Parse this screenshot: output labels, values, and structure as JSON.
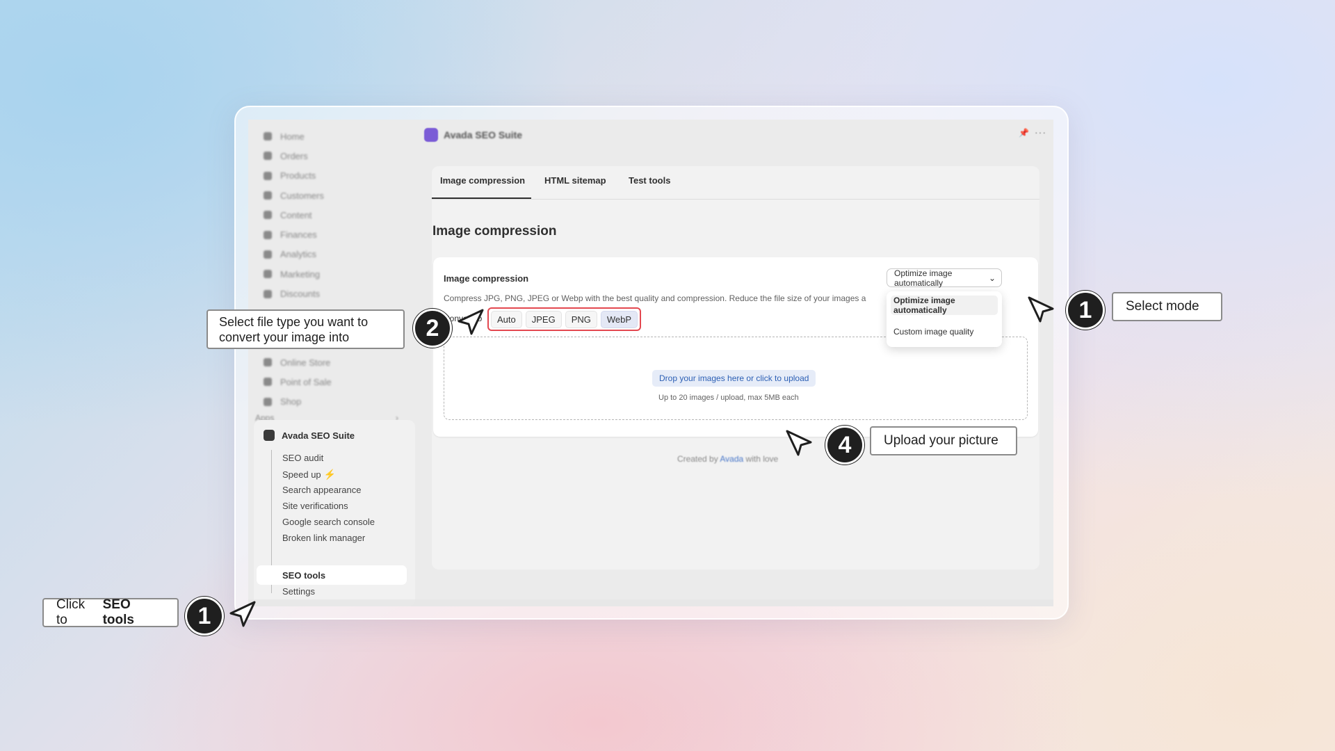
{
  "sidebar": {
    "nav_items": [
      "Home",
      "Orders",
      "Products",
      "Customers",
      "Content",
      "Finances",
      "Analytics",
      "Marketing",
      "Discounts"
    ],
    "sales_channels": [
      "Online Store",
      "Point of Sale",
      "Shop"
    ],
    "apps_label": "Apps",
    "app_name": "Avada SEO Suite",
    "app_subitems": [
      "SEO audit",
      "Speed up",
      "Search appearance",
      "Site verifications",
      "Google search console",
      "Broken link manager",
      "SEO tools",
      "Settings"
    ]
  },
  "topbar": {
    "title": "Avada SEO Suite",
    "more": "···"
  },
  "tabs": [
    "Image compression",
    "HTML sitemap",
    "Test tools"
  ],
  "page": {
    "heading": "Image compression",
    "card_title": "Image compression",
    "description": "Compress JPG, PNG, JPEG or Webp with the best quality and compression. Reduce the file size of your images a",
    "convert_label": "Convert to",
    "formats": [
      "Auto",
      "JPEG",
      "PNG",
      "WebP"
    ],
    "selected_format": "WebP",
    "mode_select": "Optimize image automatically",
    "mode_options": [
      "Optimize image automatically",
      "Custom image quality"
    ],
    "upload_button": "Drop your images here or click to upload",
    "upload_hint": "Up to 20 images / upload, max 5MB each",
    "credit_prefix": "Created by",
    "credit_link": "Avada",
    "credit_suffix": "with love"
  },
  "annotations": {
    "step1_mode": {
      "number": "1",
      "text": "Select mode"
    },
    "step2_format": {
      "number": "2",
      "text": "Select file type you want to convert your image into"
    },
    "step4_upload": {
      "number": "4",
      "text": "Upload your picture"
    },
    "step1_tools": {
      "number": "1",
      "text_prefix": "Click to",
      "text_bold": "SEO tools"
    }
  },
  "colors": {
    "accent_red": "#e34850",
    "link_blue": "#2c5fb4",
    "badge": "#1f1f1f",
    "app_purple": "#7b5cd6"
  }
}
